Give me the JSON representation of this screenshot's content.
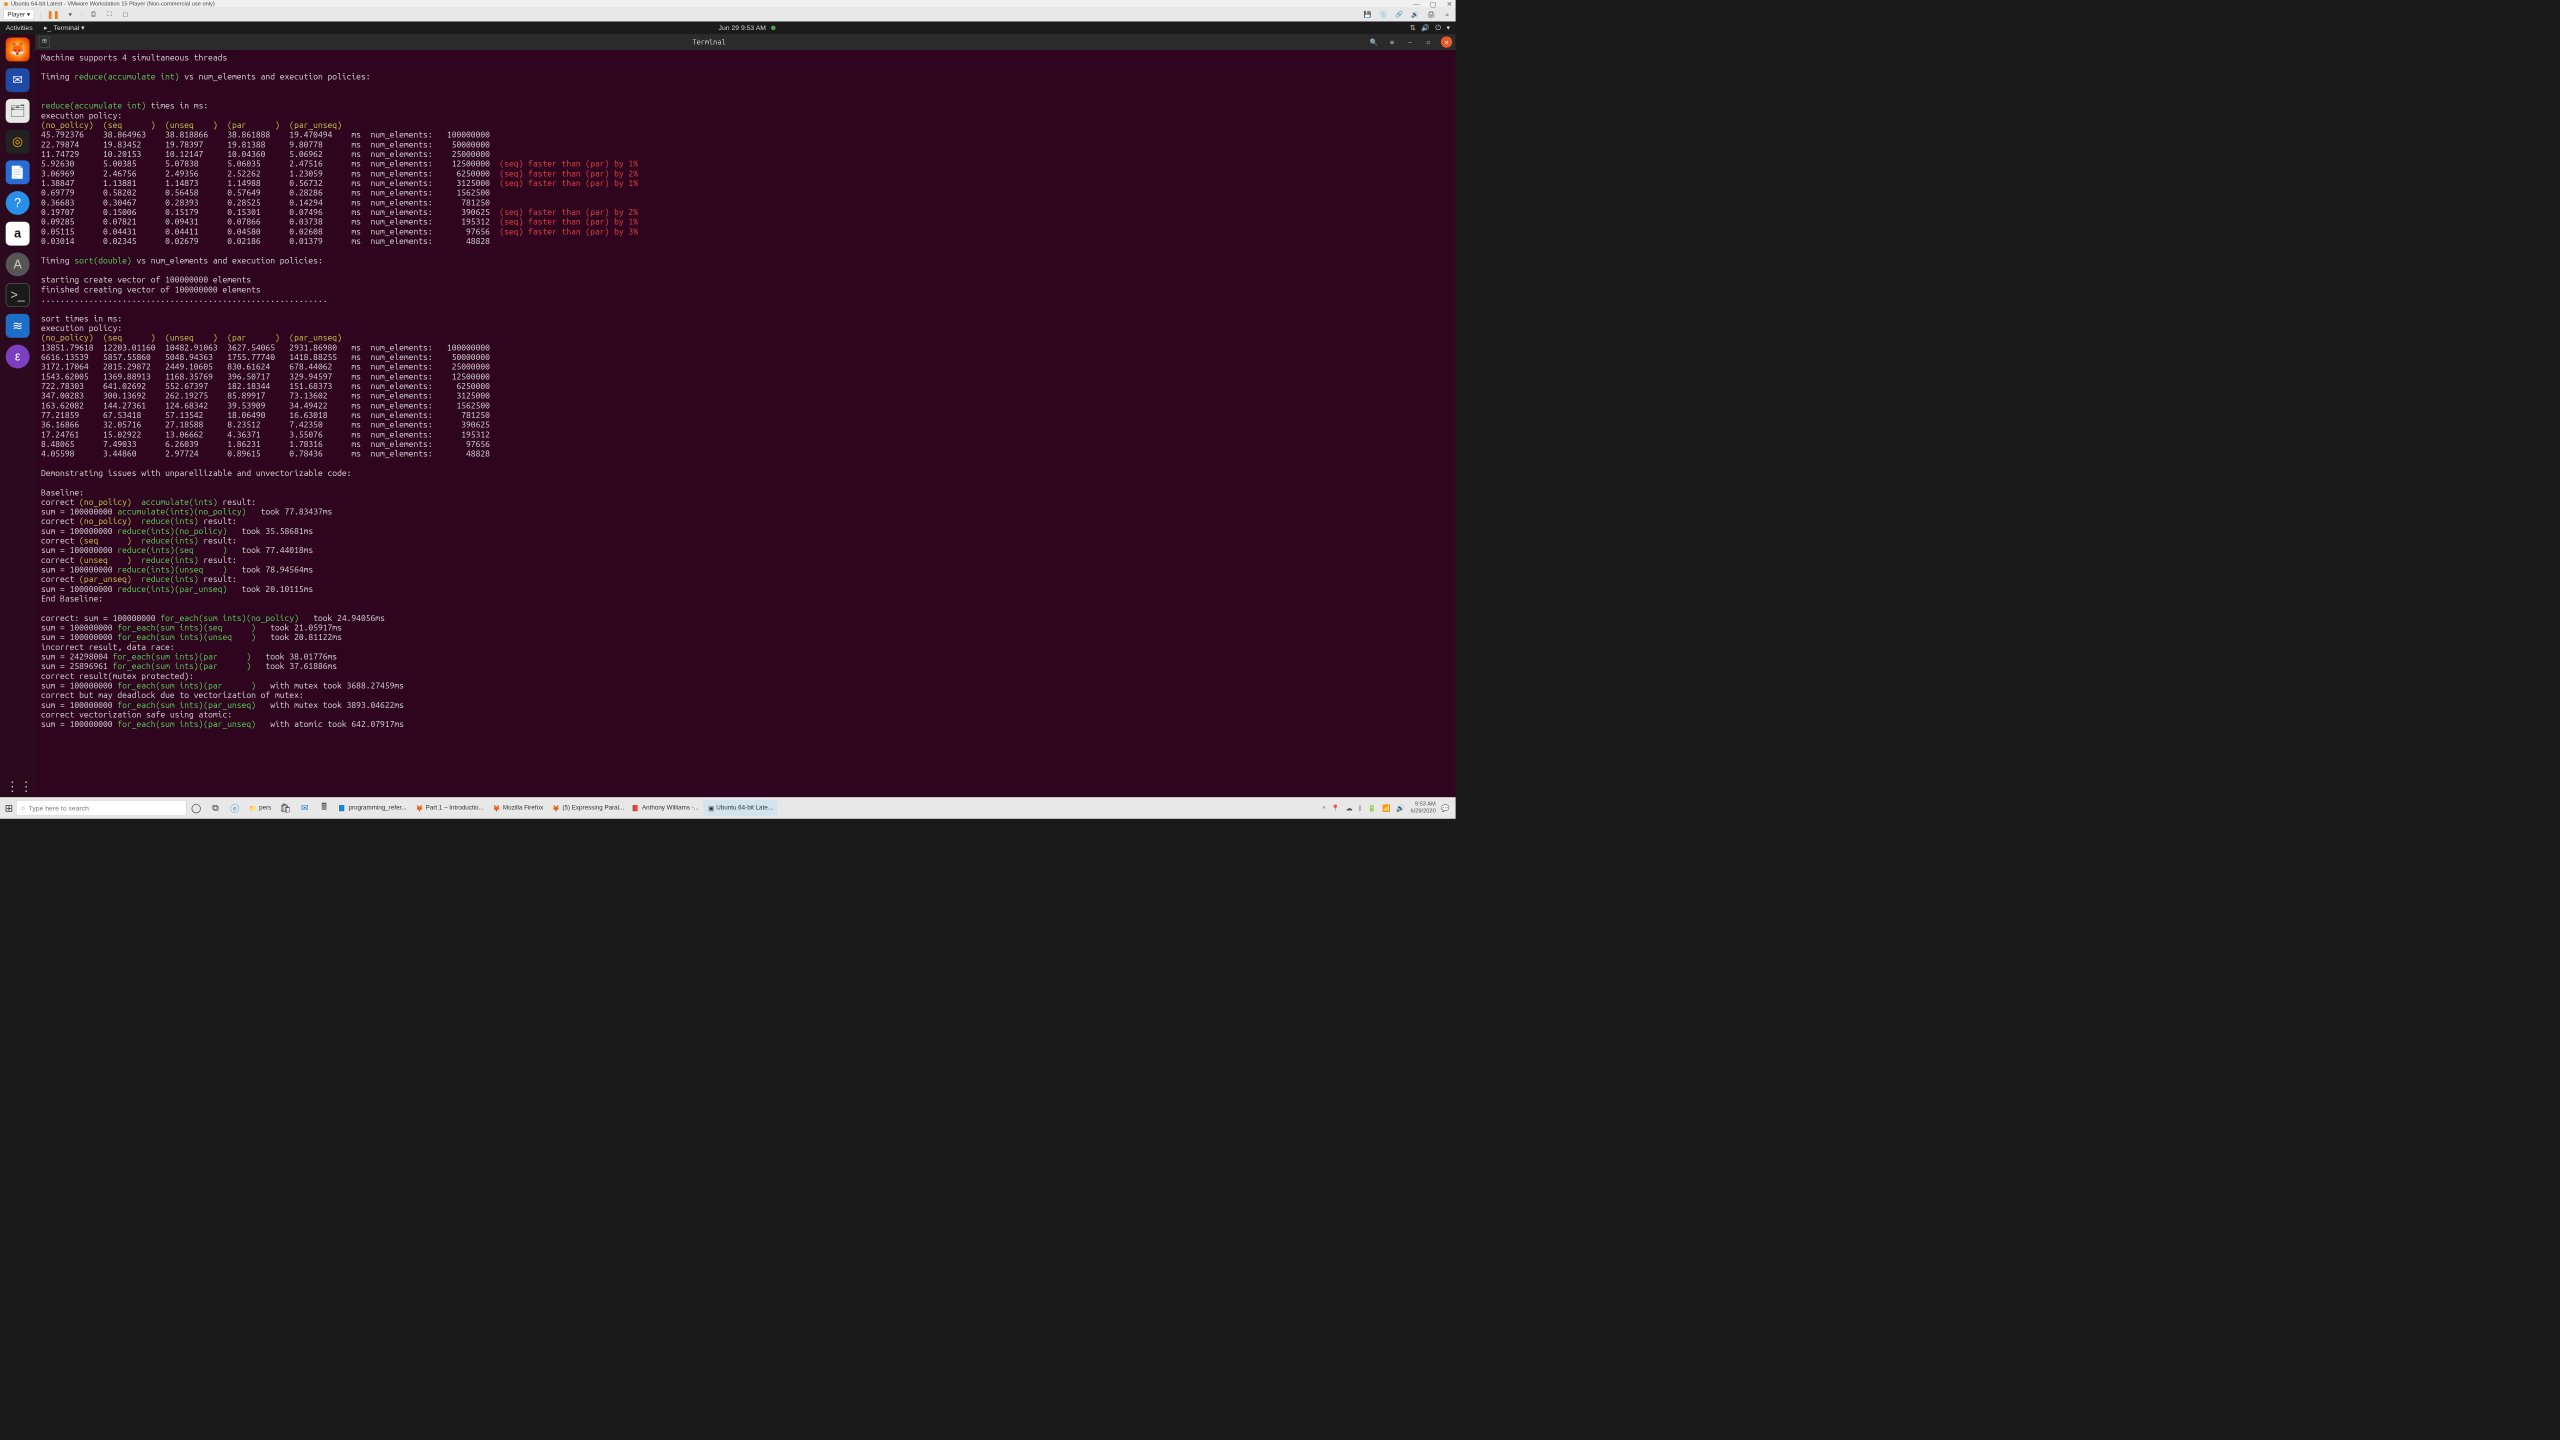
{
  "vmware": {
    "title": "Ubuntu 64-bit Latest - VMware Workstation 15 Player (Non-commercial use only)",
    "player_label": "Player ▾"
  },
  "gnome": {
    "activities": "Activities",
    "terminal_label": "Terminal ▾",
    "datetime": "Jun 29   9:53 AM"
  },
  "terminal_header": {
    "title": "Terminal"
  },
  "winbar": {
    "search_placeholder": "Type here to search",
    "tasks": {
      "pers_folder": "pers",
      "word": "programming_refer...",
      "pdf1": "Part 1 – Introductio...",
      "firefox": "Mozilla Firefox",
      "yt": "(5) Expressing Paral...",
      "adobe": "Anthony Williams -...",
      "vm": "Ubuntu 64-bit Late..."
    },
    "clock_time": "9:53 AM",
    "clock_date": "6/29/2020"
  },
  "term": {
    "l1": "Machine supports 4 simultaneous threads",
    "l2a": "Timing ",
    "l2b": "reduce(accumulate int)",
    "l2c": " vs num_elements and execution policies:",
    "l3a": "reduce(accumulate int)",
    "l3b": " times in ms:",
    "l4": "execution policy:",
    "l5": "(no_policy)  (seq      )  (unseq    )  (par      )  (par_unseq)",
    "r1": "45.792376    38.864963    38.818866    38.861888    19.470494    ms  num_elements:   100000000",
    "r2": "22.79874     19.83452     19.78397     19.81388     9.80778      ms  num_elements:    50000000",
    "r3": "11.74729     10.20153     10.12147     10.04360     5.06962      ms  num_elements:    25000000",
    "r4a": "5.92630      5.00385      5.07838      5.06035      2.47516      ms  num_elements:    12500000  ",
    "r4b": "(seq) faster than (par) by 1%",
    "r5a": "3.06969      2.46756      2.49356      2.52262      1.23059      ms  num_elements:     6250000  ",
    "r5b": "(seq) faster than (par) by 2%",
    "r6a": "1.38847      1.13881      1.14873      1.14988      0.56732      ms  num_elements:     3125000  ",
    "r6b": "(seq) faster than (par) by 1%",
    "r7": "0.69779      0.58202      0.56458      0.57649      0.28286      ms  num_elements:     1562500",
    "r8": "0.36683      0.30467      0.28393      0.28525      0.14294      ms  num_elements:      781250",
    "r9a": "0.19707      0.15006      0.15179      0.15301      0.07496      ms  num_elements:      390625  ",
    "r9b": "(seq) faster than (par) by 2%",
    "r10a": "0.09285      0.07821      0.09431      0.07866      0.03738      ms  num_elements:      195312  ",
    "r10b": "(seq) faster than (par) by 1%",
    "r11a": "0.05115      0.04431      0.04411      0.04580      0.02608      ms  num_elements:       97656  ",
    "r11b": "(seq) faster than (par) by 3%",
    "r12": "0.03014      0.02345      0.02679      0.02186      0.01379      ms  num_elements:       48828",
    "s1a": "Timing ",
    "s1b": "sort(double)",
    "s1c": " vs num_elements and execution policies:",
    "s2": "starting create vector of 100000000 elements",
    "s3": "finished creating vector of 100000000 elements",
    "s4": "............................................................",
    "s5": "sort times in ms:",
    "s6": "execution policy:",
    "s7": "(no_policy)  (seq      )  (unseq    )  (par      )  (par_unseq)",
    "sr1": "13851.79618  12203.01160  10482.91063  3627.54065   2931.86980   ms  num_elements:   100000000",
    "sr2": "6616.13539   5857.55860   5048.94363   1755.77740   1418.88255   ms  num_elements:    50000000",
    "sr3": "3172.17064   2815.29872   2449.10605   830.61624    678.44062    ms  num_elements:    25000000",
    "sr4": "1543.62005   1369.88913   1168.35769   396.50717    329.94597    ms  num_elements:    12500000",
    "sr5": "722.78303    641.02692    552.67397    182.18344    151.68373    ms  num_elements:     6250000",
    "sr6": "347.00283    300.13692    262.19275    85.89917     73.13602     ms  num_elements:     3125000",
    "sr7": "163.62082    144.27361    124.68342    39.53909     34.49422     ms  num_elements:     1562500",
    "sr8": "77.21859     67.53418     57.13542     18.06490     16.63018     ms  num_elements:      781250",
    "sr9": "36.16866     32.05716     27.18588     8.23512      7.42350      ms  num_elements:      390625",
    "sr10": "17.24761     15.02922     13.06662     4.36371      3.55076      ms  num_elements:      195312",
    "sr11": "8.48065      7.49033      6.26039      1.86231      1.78316      ms  num_elements:       97656",
    "sr12": "4.05598      3.44860      2.97724      0.89615      0.78436      ms  num_elements:       48828",
    "d1": "Demonstrating issues with unparellizable and unvectorizable code:",
    "d2": "Baseline:",
    "d3a": "correct ",
    "d3b": "(no_policy)",
    "d3c": "  ",
    "d3d": "accumulate(ints)",
    "d3e": " result:",
    "d4a": "sum = 100000000 ",
    "d4b": "accumulate(ints)(no_policy)",
    "d4c": "   took 77.83437ms",
    "d5a": "correct ",
    "d5b": "(no_policy)",
    "d5c": "  ",
    "d5d": "reduce(ints)",
    "d5e": " result:",
    "d6a": "sum = 100000000 ",
    "d6b": "reduce(ints)(no_policy)",
    "d6c": "   took 35.58681ms",
    "d7a": "correct ",
    "d7b": "(seq      )",
    "d7c": "  ",
    "d7d": "reduce(ints)",
    "d7e": " result:",
    "d8a": "sum = 100000000 ",
    "d8b": "reduce(ints)(seq      )",
    "d8c": "   took 77.44018ms",
    "d9a": "correct ",
    "d9b": "(unseq    )",
    "d9c": "  ",
    "d9d": "reduce(ints)",
    "d9e": " result:",
    "d10a": "sum = 100000000 ",
    "d10b": "reduce(ints)(unseq    )",
    "d10c": "   took 78.94564ms",
    "d11a": "correct ",
    "d11b": "(par_unseq)",
    "d11c": "  ",
    "d11d": "reduce(ints)",
    "d11e": " result:",
    "d12a": "sum = 100000000 ",
    "d12b": "reduce(ints)(par_unseq)",
    "d12c": "   took 20.10115ms",
    "d13": "End Baseline:",
    "f1a": "correct: sum = 100000000 ",
    "f1b": "for_each(sum ints)(no_policy)",
    "f1c": "   took 24.94056ms",
    "f2a": "sum = 100000000 ",
    "f2b": "for_each(sum ints)(seq      )",
    "f2c": "   took 21.05917ms",
    "f3a": "sum = 100000000 ",
    "f3b": "for_each(sum ints)(unseq    )",
    "f3c": "   took 20.81122ms",
    "f4": "incorrect result, data race:",
    "f5a": "sum = 24298004 ",
    "f5b": "for_each(sum ints)(par      )",
    "f5c": "   took 38.01776ms",
    "f6a": "sum = 25896961 ",
    "f6b": "for_each(sum ints)(par      )",
    "f6c": "   took 37.61886ms",
    "f7": "correct result(mutex protected):",
    "f8a": "sum = 100000000 ",
    "f8b": "for_each(sum ints)(par      )",
    "f8c": "   with mutex took 3688.27459ms",
    "f9": "correct but may deadlock due to vectorization of mutex:",
    "f10a": "sum = 100000000 ",
    "f10b": "for_each(sum ints)(par_unseq)",
    "f10c": "   with mutex took 3893.04622ms",
    "f11": "correct vectorization safe using atomic:",
    "f12a": "sum = 100000000 ",
    "f12b": "for_each(sum ints)(par_unseq)",
    "f12c": "   with atomic took 642.07917ms"
  }
}
